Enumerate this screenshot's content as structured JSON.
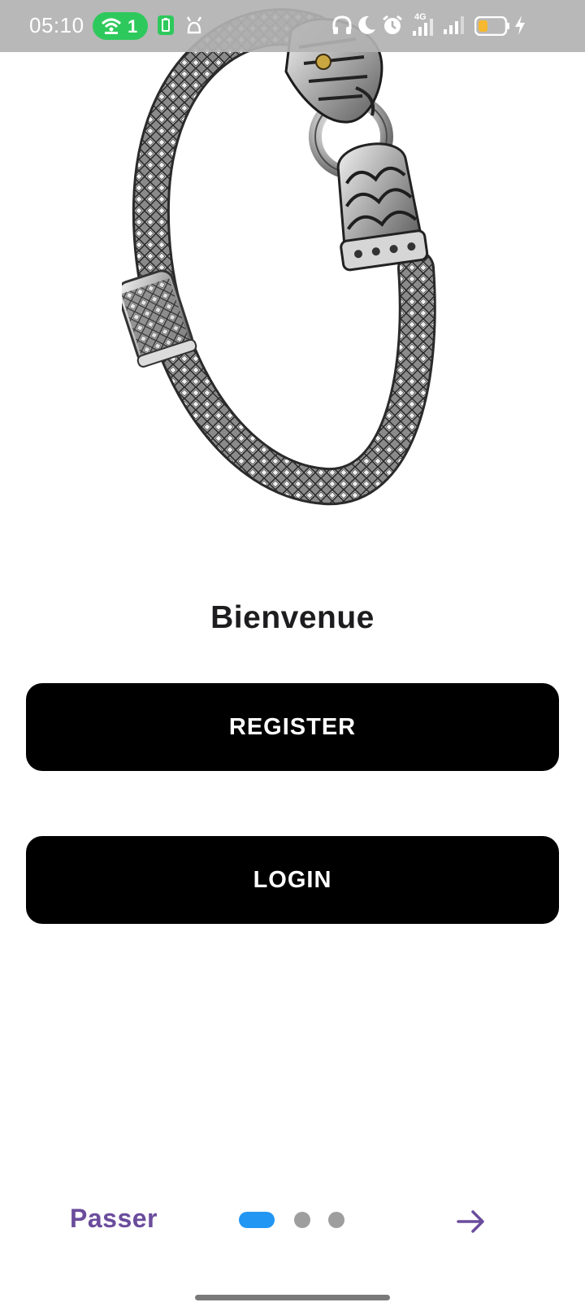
{
  "status_bar": {
    "time": "05:10",
    "hotspot_count": "1",
    "network_label": "4G",
    "icons": [
      "hotspot-icon",
      "battery-saver-icon",
      "usb-debug-icon",
      "headphones-icon",
      "moon-icon",
      "alarm-icon",
      "signal-4g-icon",
      "signal-icon",
      "battery-icon",
      "charging-icon"
    ],
    "battery_level": 0.35,
    "colors": {
      "background": "#b2b2b2",
      "hotspot_pill": "#2ec95c",
      "battery_fill": "#f5b82e"
    }
  },
  "hero": {
    "image": "silver-dragon-bracelet"
  },
  "welcome": {
    "title": "Bienvenue"
  },
  "actions": {
    "register_label": "REGISTER",
    "login_label": "LOGIN"
  },
  "onboarding": {
    "skip_label": "Passer",
    "page_count": 3,
    "current_page": 1,
    "next_icon": "arrow-right-icon",
    "colors": {
      "accent": "#6a4c9c",
      "active_dot": "#2196f3",
      "inactive_dot": "#9e9e9e"
    }
  }
}
